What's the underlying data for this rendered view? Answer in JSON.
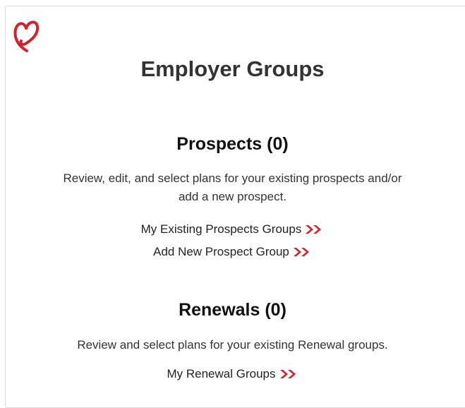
{
  "brand": {
    "logo_icon": "heart-icon",
    "accent_color": "#d6202d"
  },
  "page": {
    "title": "Employer Groups"
  },
  "prospects": {
    "heading": "Prospects (0)",
    "description_line1": "Review, edit, and select plans for your existing prospects and/or",
    "description_line2": "add a new prospect.",
    "links": [
      {
        "label": "My Existing Prospects Groups",
        "icon": "double-chevron-right-icon"
      },
      {
        "label": "Add New Prospect Group",
        "icon": "double-chevron-right-icon"
      }
    ]
  },
  "renewals": {
    "heading": "Renewals (0)",
    "description": "Review and select plans for your existing Renewal groups.",
    "links": [
      {
        "label": "My Renewal Groups",
        "icon": "double-chevron-right-icon"
      }
    ]
  }
}
